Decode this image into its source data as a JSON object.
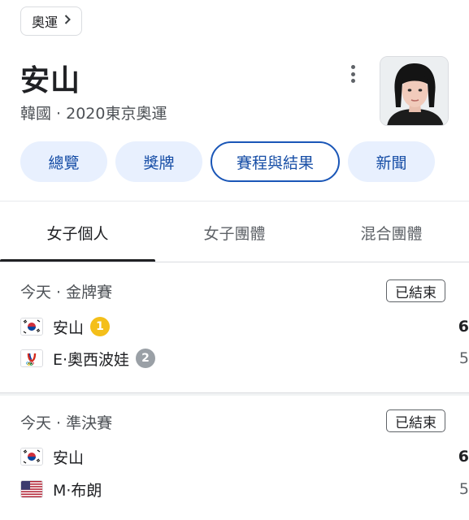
{
  "breadcrumb": {
    "label": "奧運",
    "chevron_icon": "chevron-right-icon"
  },
  "athlete": {
    "name": "安山",
    "subtitle": "韓國 · 2020東京奧運"
  },
  "chips": [
    {
      "label": "總覽",
      "active": false
    },
    {
      "label": "獎牌",
      "active": false
    },
    {
      "label": "賽程與結果",
      "active": true
    },
    {
      "label": "新聞",
      "active": false
    }
  ],
  "tabs": [
    {
      "label": "女子個人",
      "active": true
    },
    {
      "label": "女子團體",
      "active": false
    },
    {
      "label": "混合團體",
      "active": false
    }
  ],
  "matches": [
    {
      "stage": "今天 · 金牌賽",
      "status": "已結束",
      "competitors": [
        {
          "flag": "kr-flag-icon",
          "name": "安山",
          "medal": "1",
          "score": "6",
          "winner": true
        },
        {
          "flag": "roc-flag-icon",
          "name": "E·奧西波娃",
          "medal": "2",
          "score": "5",
          "winner": false
        }
      ]
    },
    {
      "stage": "今天 · 準決賽",
      "status": "已結束",
      "competitors": [
        {
          "flag": "kr-flag-icon",
          "name": "安山",
          "medal": "",
          "score": "6",
          "winner": true
        },
        {
          "flag": "us-flag-icon",
          "name": "M·布朗",
          "medal": "",
          "score": "5",
          "winner": false
        }
      ]
    }
  ],
  "colors": {
    "accent": "#1a56b7",
    "chip_bg": "#e8f0fe",
    "gold": "#f4bf1a",
    "silver": "#9aa0a6"
  }
}
